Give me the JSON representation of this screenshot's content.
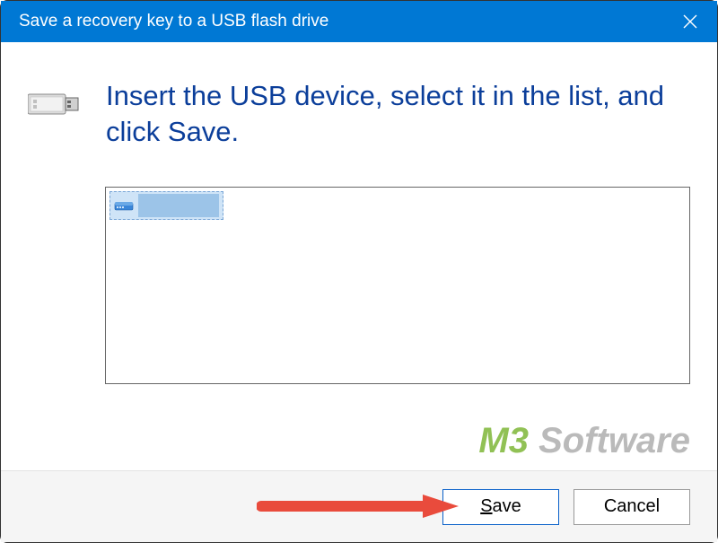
{
  "titlebar": {
    "title": "Save a recovery key to a USB flash drive"
  },
  "instruction": "Insert the USB device, select it in the list, and click Save.",
  "device_list": {
    "items": [
      {
        "label": ""
      }
    ]
  },
  "buttons": {
    "save": "Save",
    "cancel": "Cancel"
  },
  "watermark": {
    "part1": "M",
    "part2": "3",
    "part3": " Software"
  }
}
